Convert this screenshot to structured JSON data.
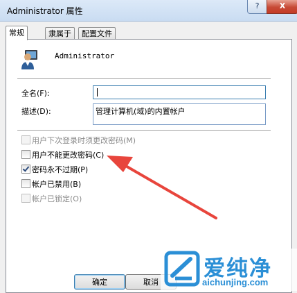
{
  "window": {
    "title": "Administrator 属性",
    "help_label": "?",
    "close_label": "X"
  },
  "tabs": [
    {
      "label": "常规",
      "active": true
    },
    {
      "label": "隶属于",
      "active": false
    },
    {
      "label": "配置文件",
      "active": false
    }
  ],
  "user": {
    "name": "Administrator",
    "avatar_icon": "user-avatar-icon"
  },
  "form": {
    "fullname_label": "全名(F):",
    "fullname_value": "",
    "description_label": "描述(D):",
    "description_value": "管理计算机(域)的内置帐户"
  },
  "options": [
    {
      "label": "用户下次登录时须更改密码(M)",
      "checked": false,
      "disabled": true
    },
    {
      "label": "用户不能更改密码(C)",
      "checked": false,
      "disabled": false
    },
    {
      "label": "密码永不过期(P)",
      "checked": true,
      "disabled": false
    },
    {
      "label": "帐户已禁用(B)",
      "checked": false,
      "disabled": false
    },
    {
      "label": "帐户已锁定(O)",
      "checked": false,
      "disabled": true
    }
  ],
  "buttons": {
    "ok_label": "确定",
    "cancel_label": "取消"
  },
  "annotation": {
    "color": "#e8453c"
  },
  "watermark": {
    "brand": "爱纯净",
    "url": "aichunjing.com",
    "color": "#2b8fd6"
  }
}
